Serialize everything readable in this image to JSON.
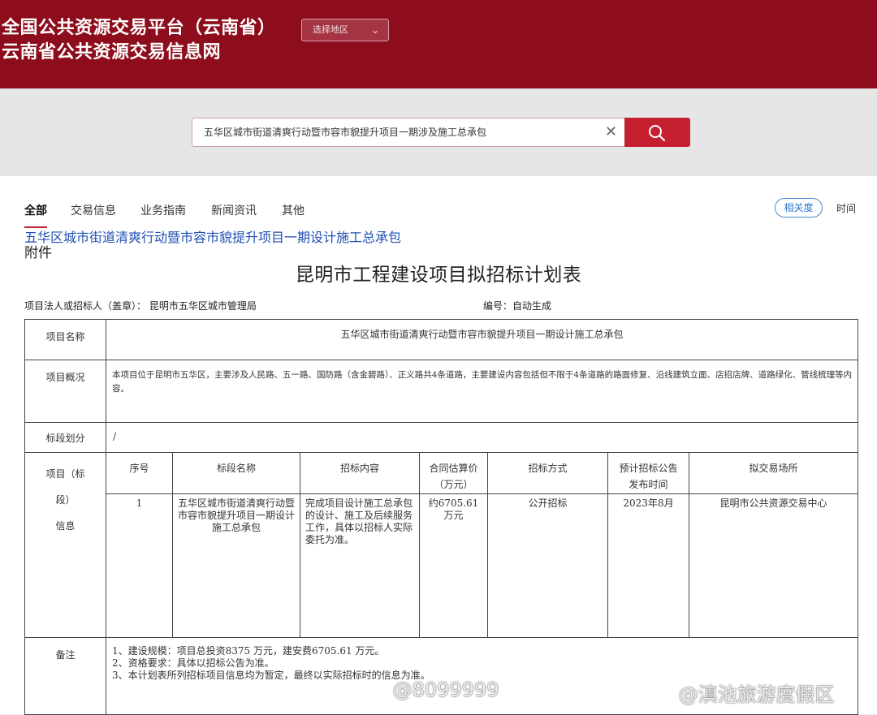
{
  "header": {
    "title_line1": "全国公共资源交易平台（云南省）",
    "title_line2": "云南省公共资源交易信息网",
    "region_select": "选择地区"
  },
  "search": {
    "value": "五华区城市街道清爽行动暨市容市貌提升项目一期涉及施工总承包",
    "clear_icon": "close-icon",
    "button_icon": "search-icon"
  },
  "tabs": [
    "全部",
    "交易信息",
    "业务指南",
    "新闻资讯",
    "其他"
  ],
  "sort": {
    "relevance": "相关度",
    "time": "时间"
  },
  "result": {
    "link": "五华区城市街道清爽行动暨市容市貌提升项目一期设计施工总承包",
    "attachment": "附件"
  },
  "doc": {
    "title": "昆明市工程建设项目拟招标计划表",
    "tenderer": "项目法人或招标人（盖章）：  昆明市五华区城市管理局",
    "number": "编号：自动生成",
    "rows": {
      "name_label": "项目名称",
      "name_value": "五华区城市街道清爽行动暨市容市貌提升项目一期设计施工总承包",
      "overview_label": "项目概况",
      "overview_value": "本项目位于昆明市五华区，主要涉及人民路、五一路、国防路（含金碧路）、正义路共4条道路，主要建设内容包括但不限于4条道路的路面修复、沿线建筑立面、店招店牌、道路绿化、管线梳理等内容。",
      "section_label": "标段划分",
      "section_value": "/",
      "info_label": [
        "项目（标",
        "段）",
        "信息"
      ],
      "notes_label": "备注"
    },
    "columns": [
      "序号",
      "标段名称",
      "招标内容",
      "合同估算价",
      "（万元）",
      "招标方式",
      "预计招标公告",
      "发布时间",
      "拟交易场所"
    ],
    "item": {
      "no": "1",
      "name": "五华区城市街道清爽行动暨市容市貌提升项目一期设计施工总承包",
      "content": "完成项目设计施工总承包的设计、施工及后续服务工作，具体以招标人实际委托为准。",
      "price": "约6705.61 万元",
      "method": "公开招标",
      "date": "2023年8月",
      "venue": "昆明市公共资源交易中心"
    },
    "notes": [
      "1、建设规模：项目总投资8375 万元，建安费6705.61 万元。",
      "2、资格要求：具体以招标公告为准。",
      "3、本计划表所列招标项目信息均为暂定，最终以实际招标时的信息为准。"
    ]
  },
  "watermarks": [
    "@8099999",
    "@滇池旅游度假区"
  ]
}
